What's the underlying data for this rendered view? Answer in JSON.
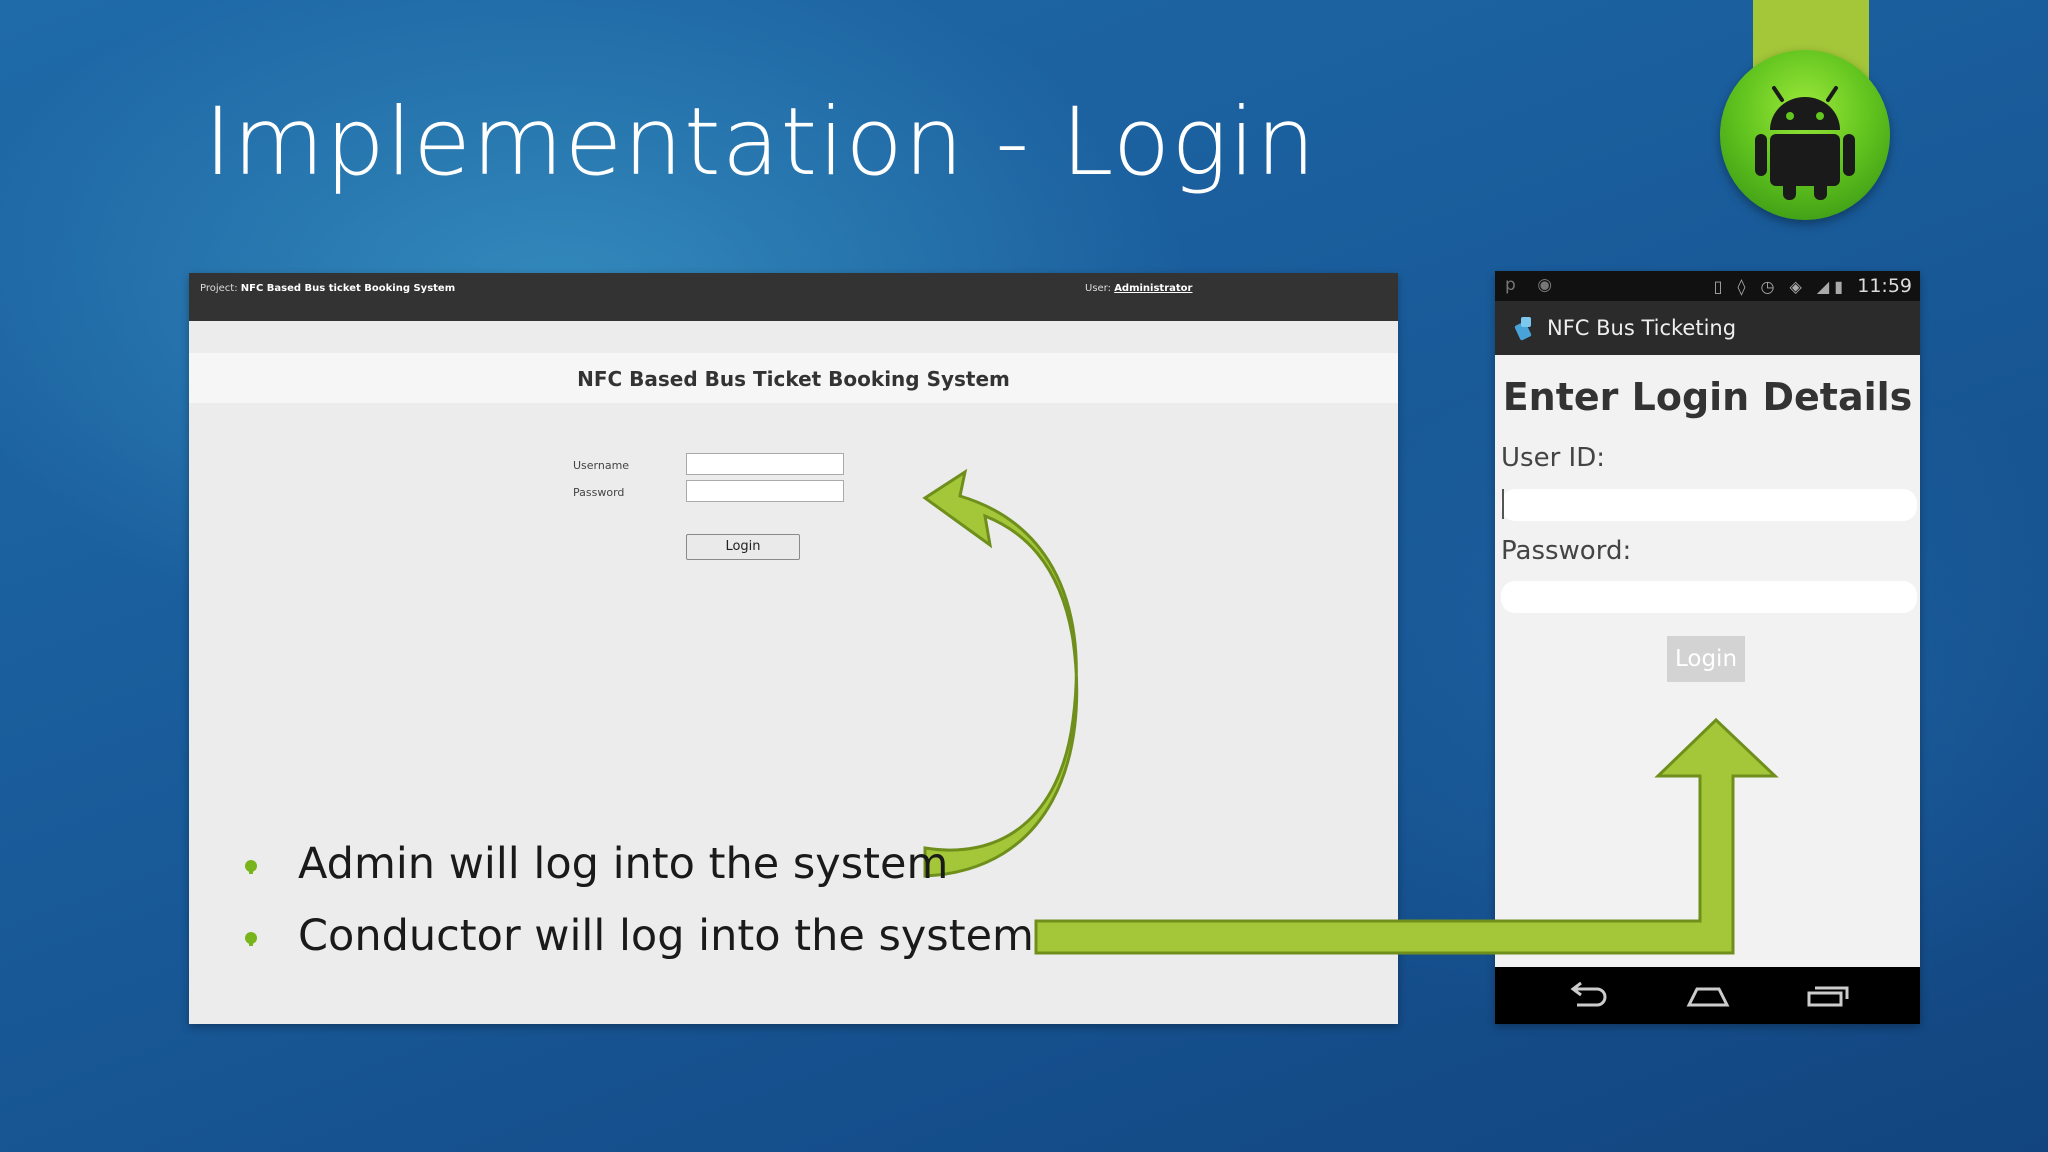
{
  "slide": {
    "title": "Implementation - Login",
    "bullets": [
      "Admin will log into the system",
      "Conductor will log into the system"
    ],
    "colors": {
      "background": "#1b5c99",
      "accent": "#a4c739",
      "bullet": "#7ab41d"
    },
    "badge_icon": "android-robot-icon"
  },
  "web": {
    "project_label": "Project:",
    "project_name": "NFC Based Bus ticket Booking System",
    "user_label": "User:",
    "user_name": "Administrator",
    "heading": "NFC Based Bus Ticket Booking System",
    "username_label": "Username",
    "password_label": "Password",
    "username_value": "",
    "password_value": "",
    "login_button": "Login"
  },
  "phone": {
    "status_time": "11:59",
    "app_title": "NFC Bus Ticketing",
    "heading": "Enter Login Details",
    "userid_label": "User ID:",
    "password_label": "Password:",
    "userid_value": "",
    "password_value": "",
    "login_button": "Login"
  }
}
